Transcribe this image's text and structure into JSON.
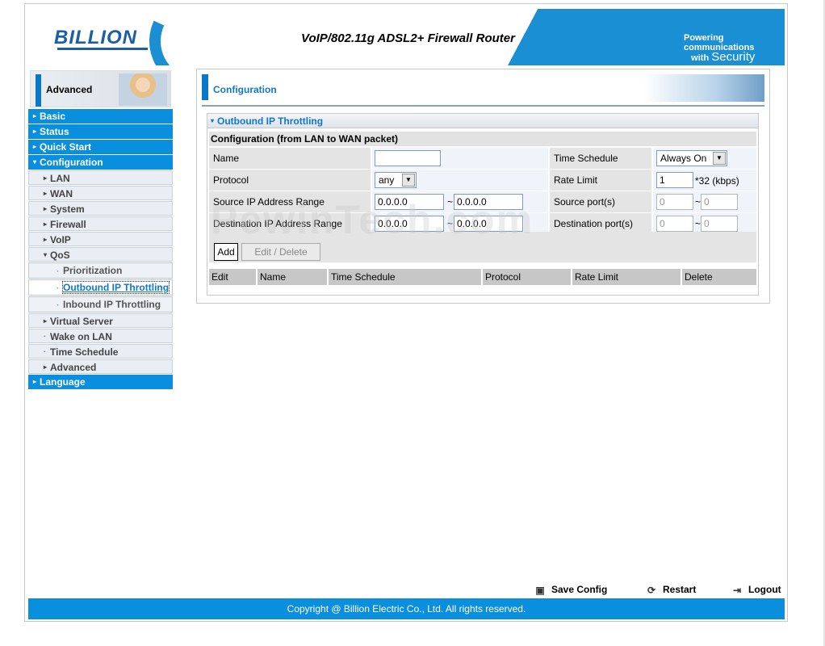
{
  "header": {
    "logo": "BILLION",
    "title": "VoIP/802.11g ADSL2+ Firewall Router",
    "tagline_line1": "Powering communications",
    "tagline_line2": "with",
    "tagline_line3": "Security"
  },
  "sidebar": {
    "banner": "Advanced",
    "items": [
      {
        "label": "Basic"
      },
      {
        "label": "Status"
      },
      {
        "label": "Quick Start"
      },
      {
        "label": "Configuration"
      },
      {
        "label": "LAN"
      },
      {
        "label": "WAN"
      },
      {
        "label": "System"
      },
      {
        "label": "Firewall"
      },
      {
        "label": "VoIP"
      },
      {
        "label": "QoS"
      },
      {
        "label": "Prioritization"
      },
      {
        "label": "Outbound IP Throttling"
      },
      {
        "label": "Inbound IP Throttling"
      },
      {
        "label": "Virtual Server"
      },
      {
        "label": "Wake on LAN"
      },
      {
        "label": "Time Schedule"
      },
      {
        "label": "Advanced"
      },
      {
        "label": "Language"
      }
    ]
  },
  "main": {
    "page_title": "Configuration",
    "section_title": "Outbound IP Throttling",
    "subsection_title": "Configuration (from LAN to WAN packet)",
    "form": {
      "name_label": "Name",
      "name_value": "",
      "time_schedule_label": "Time Schedule",
      "time_schedule_value": "Always On",
      "protocol_label": "Protocol",
      "protocol_value": "any",
      "rate_limit_label": "Rate Limit",
      "rate_limit_value": "1",
      "rate_limit_unit": "*32 (kbps)",
      "src_ip_label": "Source IP Address Range",
      "src_ip_start": "0.0.0.0",
      "src_ip_end": "0.0.0.0",
      "src_port_label": "Source port(s)",
      "src_port_start": "0",
      "src_port_end": "0",
      "dst_ip_label": "Destination IP Address Range",
      "dst_ip_start": "0.0.0.0",
      "dst_ip_end": "0.0.0.0",
      "dst_port_label": "Destination port(s)",
      "dst_port_start": "0",
      "dst_port_end": "0",
      "range_sep": "~"
    },
    "buttons": {
      "add": "Add",
      "edit_delete": "Edit / Delete"
    },
    "table_headers": [
      "Edit",
      "Name",
      "Time Schedule",
      "Protocol",
      "Rate Limit",
      "Delete"
    ]
  },
  "tools": {
    "save": "Save Config",
    "restart": "Restart",
    "logout": "Logout"
  },
  "footer": "Copyright @ Billion Electric Co., Ltd. All rights reserved.",
  "watermark": "PewinTech.com"
}
